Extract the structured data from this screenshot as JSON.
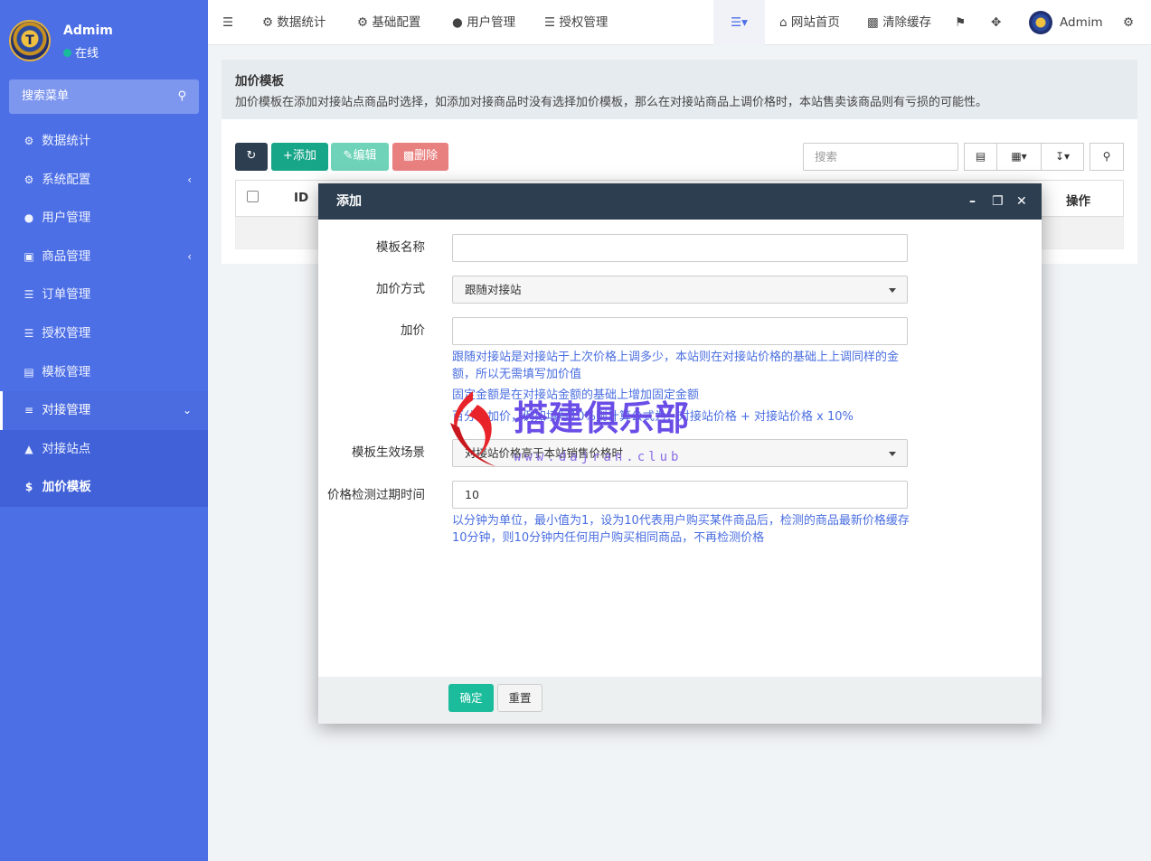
{
  "user": {
    "name": "Admim",
    "status": "在线",
    "avatar_text": "T"
  },
  "sidebar": {
    "search_label": "搜索菜单",
    "items": [
      {
        "label": "数据统计"
      },
      {
        "label": "系统配置"
      },
      {
        "label": "用户管理"
      },
      {
        "label": "商品管理"
      },
      {
        "label": "订单管理"
      },
      {
        "label": "授权管理"
      },
      {
        "label": "模板管理"
      },
      {
        "label": "对接管理"
      }
    ],
    "sub_items": [
      {
        "label": "对接站点"
      },
      {
        "label": "加价模板"
      }
    ]
  },
  "topbar": {
    "nav": [
      "数据统计",
      "基础配置",
      "用户管理",
      "授权管理"
    ],
    "home": "网站首页",
    "clear_cache": "清除缓存",
    "user": "Admim"
  },
  "header": {
    "title": "加价模板",
    "description": "加价模板在添加对接站点商品时选择，如添加对接商品时没有选择加价模板，那么在对接站商品上调价格时，本站售卖该商品则有亏损的可能性。"
  },
  "toolbar": {
    "add": "添加",
    "edit": "编辑",
    "delete": "删除",
    "search_placeholder": "搜索"
  },
  "table": {
    "columns": [
      "ID",
      "操作"
    ]
  },
  "modal": {
    "title": "添加",
    "fields": {
      "name_label": "模板名称",
      "name_value": "",
      "method_label": "加价方式",
      "method_value": "跟随对接站",
      "markup_label": "加价",
      "markup_value": "",
      "markup_help_1": "跟随对接站是对接站于上次价格上调多少，本站则在对接站价格的基础上上调同样的金额，所以无需填写加价值",
      "markup_help_2": "固定金额是在对接站金额的基础上增加固定金额",
      "markup_help_3": "百分比加价，例如填写10%则计算公式为：对接站价格 + 对接站价格 x 10%",
      "scene_label": "模板生效场景",
      "scene_value": "对接站价格高于本站销售价格时",
      "expire_label": "价格检测过期时间",
      "expire_value": "10",
      "expire_help": "以分钟为单位，最小值为1，设为10代表用户购买某件商品后，检测的商品最新价格缓存10分钟，则10分钟内任何用户购买相同商品，不再检测价格"
    },
    "confirm": "确定",
    "reset": "重置"
  },
  "watermark": {
    "title": "搭建俱乐部",
    "url": "www.dajran.club"
  },
  "colors": {
    "sidebar": "#4d6fe6",
    "modal_header": "#2c3e50",
    "add_btn": "#18a689",
    "edit_btn": "#6fd3b9",
    "delete_btn": "#e88080",
    "confirm_btn": "#1abc9c"
  }
}
